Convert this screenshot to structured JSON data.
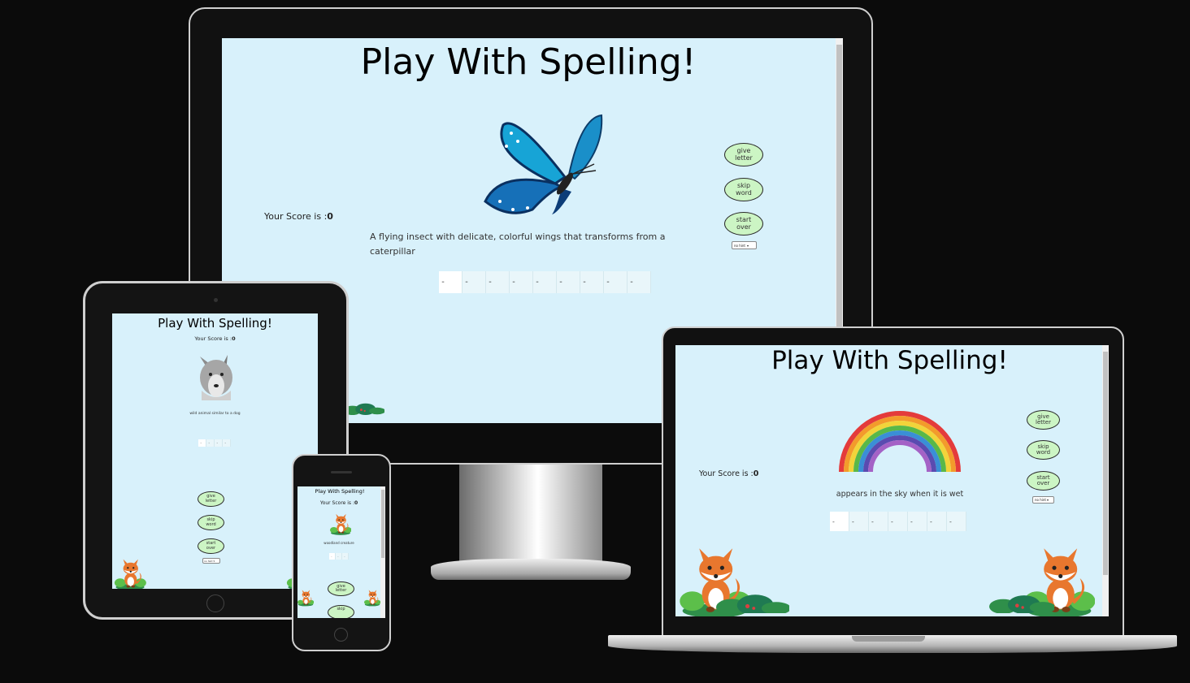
{
  "app_title": "Play With Spelling!",
  "colors": {
    "page_bg": "#d8f1fb",
    "button_bg": "#ccf5c4",
    "frame": "#0b0b0b"
  },
  "devices": {
    "desktop": {
      "score_label": "Your Score is :",
      "score_value": "0",
      "clue": "A flying insect with delicate, colorful wings that transforms from a caterpillar",
      "picture": "butterfly-image",
      "letters": [
        "-",
        "-",
        "-",
        "-",
        "-",
        "-",
        "-",
        "-",
        "-"
      ],
      "buttons": {
        "give_letter": "give letter",
        "skip_word": "skip word",
        "start_over": "start over"
      },
      "hint_select": "no hint"
    },
    "tablet": {
      "score_label": "Your Score is :",
      "score_value": "0",
      "clue": "wild animal similar to a dog",
      "picture": "wolf-image",
      "letters": [
        "-",
        "-",
        "-",
        "-"
      ],
      "buttons": {
        "give_letter": "give letter",
        "skip_word": "skip word",
        "start_over": "start over"
      },
      "hint_select": "no hint"
    },
    "phone": {
      "score_label": "Your Score is :",
      "score_value": "0",
      "clue": "woodland creature",
      "picture": "fox-image",
      "letters": [
        "-",
        "-",
        "-"
      ],
      "buttons": {
        "give_letter": "give letter",
        "skip_word": "skip"
      }
    },
    "laptop": {
      "score_label": "Your Score is :",
      "score_value": "0",
      "clue": "appears in the sky when it is wet",
      "picture": "rainbow-image",
      "letters": [
        "-",
        "-",
        "-",
        "-",
        "-",
        "-",
        "-"
      ],
      "buttons": {
        "give_letter": "give letter",
        "skip_word": "skip word",
        "start_over": "start over"
      },
      "hint_select": "no hint"
    }
  }
}
